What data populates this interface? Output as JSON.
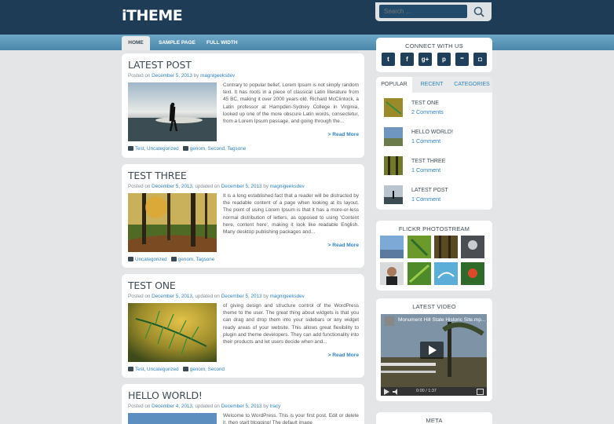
{
  "header": {
    "logo": "iTHEME",
    "search_placeholder": "Search ..."
  },
  "nav": {
    "items": [
      "HOME",
      "SAMPLE PAGE",
      "FULL WIDTH"
    ]
  },
  "posts": [
    {
      "title": "LATEST POST",
      "meta_prefix": "Posted on",
      "date": "December 5, 2013",
      "updated_prefix": "",
      "updated": "",
      "by": "by",
      "author": "magnigeeksdev",
      "excerpt": "Contrary to popular belief, Lorem Ipsum is not simply random text. It has roots in a piece of classical Latin literature from 45 BC, making it over 2000 years old. Richard McClintock, a Latin professor at Hampden-Sydney College in Virginia, looked up one of the more obscure Latin words, consectetur, from a Lorem Ipsum passage, and going through the...",
      "read_more": "> Read More",
      "categories": "Test, Uncategorized",
      "tags": "genom, Second, Tagsone"
    },
    {
      "title": "TEST THREE",
      "meta_prefix": "Posted on",
      "date": "December 5, 2013,",
      "updated_prefix": "updated on",
      "updated": "December 5, 2013",
      "by": "by",
      "author": "magnigeeksdev",
      "excerpt": "It is a long established fact that a reader will be distracted by the readable content of a page when looking at its layout. The point of using Lorem Ipsum is that it has a more-or-less normal distribution of letters, as opposed to using 'Content here, content here', making it look like readable English. Many desktop publishing packages and...",
      "read_more": "> Read More",
      "categories": "Uncategorized",
      "tags": "genom, Tagsone"
    },
    {
      "title": "TEST ONE",
      "meta_prefix": "Posted on",
      "date": "December 5, 2013,",
      "updated_prefix": "updated on",
      "updated": "December 5, 2013",
      "by": "by",
      "author": "magnigeeksdev",
      "excerpt": "of giving design and structure control of the WordPress theme to the user. The great thing about widgets is that you can drag and drop them into your sidebars or any widget ready areas of your website. This allows great flexibility to plugin and theme developers. They can add functionality into their products and let users decide when and...",
      "read_more": "> Read More",
      "categories": "Test, Uncategorized",
      "tags": "genom, Second"
    },
    {
      "title": "HELLO WORLD!",
      "meta_prefix": "Posted on",
      "date": "December 4, 2013,",
      "updated_prefix": "updated on",
      "updated": "December 5, 2013",
      "by": "by",
      "author": "tracy",
      "excerpt": "Welcome to WordPress. This is your first post. Edit or delete it, then start blogging! The default image",
      "read_more": "",
      "categories": "",
      "tags": ""
    }
  ],
  "sidebar": {
    "connect_title": "CONNECT WITH US",
    "social": [
      {
        "icon": "twitter-icon",
        "glyph": "t"
      },
      {
        "icon": "facebook-icon",
        "glyph": "f"
      },
      {
        "icon": "google-plus-icon",
        "glyph": "g+"
      },
      {
        "icon": "pinterest-icon",
        "glyph": "p"
      },
      {
        "icon": "flickr-icon",
        "glyph": "••"
      },
      {
        "icon": "instagram-icon",
        "glyph": "◘"
      }
    ],
    "tabs": [
      "POPULAR",
      "RECENT",
      "CATEGORIES"
    ],
    "popular": [
      {
        "title": "TEST ONE",
        "comments": "2 Comments"
      },
      {
        "title": "HELLO WORLD!",
        "comments": "1 Comment"
      },
      {
        "title": "TEST THREE",
        "comments": "1 Comment"
      },
      {
        "title": "LATEST POST",
        "comments": "1 Comment"
      }
    ],
    "flickr_title": "FLICKR PHOTOSTREAM",
    "video_title": "LATEST VIDEO",
    "video_caption": "Monument Hill State Historic Site.mp...",
    "video_time": "0:00 / 1:37",
    "meta_title": "META"
  },
  "colors": {
    "header": "#1e3c56",
    "link": "#2f82bf",
    "nav": "#5a97b9"
  }
}
